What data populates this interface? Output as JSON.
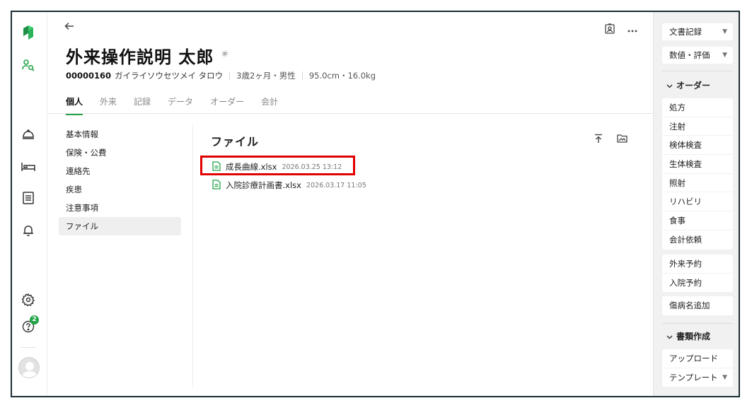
{
  "header": {
    "patient_name": "外来操作説明 太郎",
    "patient_id": "00000160",
    "kana": "ガイライソウセツメイ タロウ",
    "age_sex": "3歳2ヶ月・男性",
    "body": "95.0cm・16.0kg"
  },
  "rail": {
    "badge_count": "2"
  },
  "tabs": [
    {
      "label": "個人",
      "active": true
    },
    {
      "label": "外来"
    },
    {
      "label": "記録"
    },
    {
      "label": "データ"
    },
    {
      "label": "オーダー"
    },
    {
      "label": "会計"
    }
  ],
  "submenu": [
    {
      "label": "基本情報"
    },
    {
      "label": "保険・公費"
    },
    {
      "label": "連絡先"
    },
    {
      "label": "疾患"
    },
    {
      "label": "注意事項"
    },
    {
      "label": "ファイル",
      "active": true
    }
  ],
  "files": {
    "title": "ファイル",
    "items": [
      {
        "name": "成長曲線.xlsx",
        "date": "2026.03.25 13:12",
        "highlighted": true
      },
      {
        "name": "入院診療計画書.xlsx",
        "date": "2026.03.17 11:05"
      }
    ]
  },
  "right_panel": {
    "dropdowns": [
      {
        "label": "文書記録"
      },
      {
        "label": "数値・評価"
      }
    ],
    "order_section": "オーダー",
    "order_items": [
      "処方",
      "注射",
      "検体検査",
      "生体検査",
      "照射",
      "リハビリ",
      "食事",
      "会計依頼"
    ],
    "appointment_items": [
      "外来予約",
      "入院予約"
    ],
    "disease_button": "傷病名追加",
    "document_section": "書類作成",
    "document_items": [
      "アップロード",
      "テンプレート"
    ]
  },
  "colors": {
    "accent": "#22a447",
    "highlight": "#e10000"
  }
}
